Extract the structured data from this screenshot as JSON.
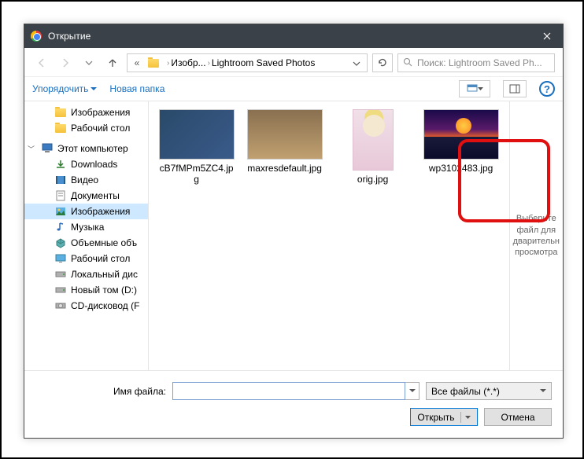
{
  "window": {
    "title": "Открытие"
  },
  "breadcrumb": {
    "part1": "Изобр...",
    "part2": "Lightroom Saved Photos"
  },
  "search": {
    "placeholder": "Поиск: Lightroom Saved Ph..."
  },
  "toolbar": {
    "organize": "Упорядочить",
    "new_folder": "Новая папка"
  },
  "sidebar": {
    "items": [
      {
        "label": "Изображения",
        "icon": "folder"
      },
      {
        "label": "Рабочий стол",
        "icon": "folder"
      },
      {
        "label": "Этот компьютер",
        "icon": "pc",
        "pc": true
      },
      {
        "label": "Downloads",
        "icon": "downloads"
      },
      {
        "label": "Видео",
        "icon": "video"
      },
      {
        "label": "Документы",
        "icon": "docs"
      },
      {
        "label": "Изображения",
        "icon": "images",
        "selected": true
      },
      {
        "label": "Музыка",
        "icon": "music"
      },
      {
        "label": "Объемные объ",
        "icon": "3d"
      },
      {
        "label": "Рабочий стол",
        "icon": "desktop"
      },
      {
        "label": "Локальный дис",
        "icon": "drive"
      },
      {
        "label": "Новый том (D:)",
        "icon": "drive"
      },
      {
        "label": "CD-дисковод (F",
        "icon": "cd"
      }
    ]
  },
  "files": [
    {
      "name": "cB7fMPm5ZC4.jpg",
      "thumb": "t1"
    },
    {
      "name": "maxresdefault.jpg",
      "thumb": "t2"
    },
    {
      "name": "orig.jpg",
      "thumb": "t3"
    },
    {
      "name": "wp3102483.jpg",
      "thumb": "t4",
      "highlighted": true
    }
  ],
  "preview": {
    "text": "Выберите файл для дварительн просмотра"
  },
  "filename": {
    "label": "Имя файла:",
    "value": ""
  },
  "filter": {
    "label": "Все файлы (*.*)"
  },
  "buttons": {
    "open": "Открыть",
    "cancel": "Отмена"
  }
}
